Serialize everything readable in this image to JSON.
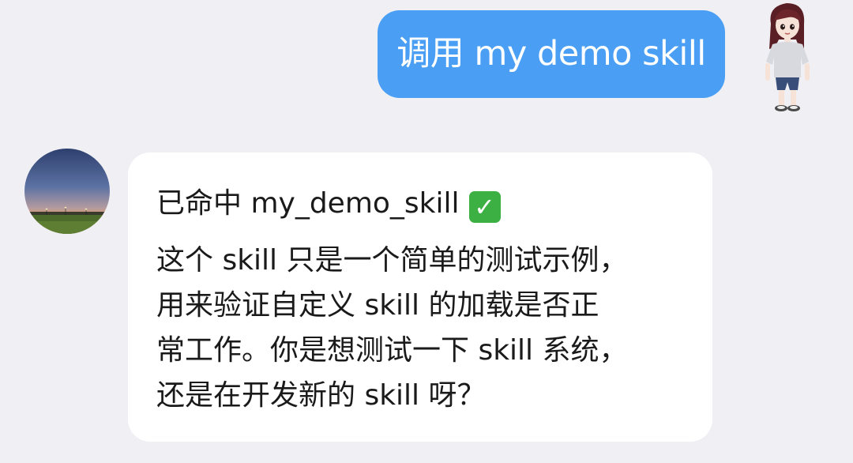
{
  "chat": {
    "outgoing": {
      "text": "调用 my demo skill"
    },
    "incoming": {
      "hit_text": "已命中 my_demo_skill",
      "hit_icon": "check-mark-button-icon",
      "lines": [
        "这个 skill 只是一个简单的测试示例，",
        "用来验证自定义 skill 的加载是否正",
        "常工作。你是想测试一下 skill 系统，",
        "还是在开发新的 skill 呀？"
      ]
    }
  },
  "colors": {
    "background": "#EFEFF4",
    "outgoing_bubble": "#4A9FF5",
    "incoming_bubble": "#FFFFFF",
    "check": "#3CB043"
  }
}
